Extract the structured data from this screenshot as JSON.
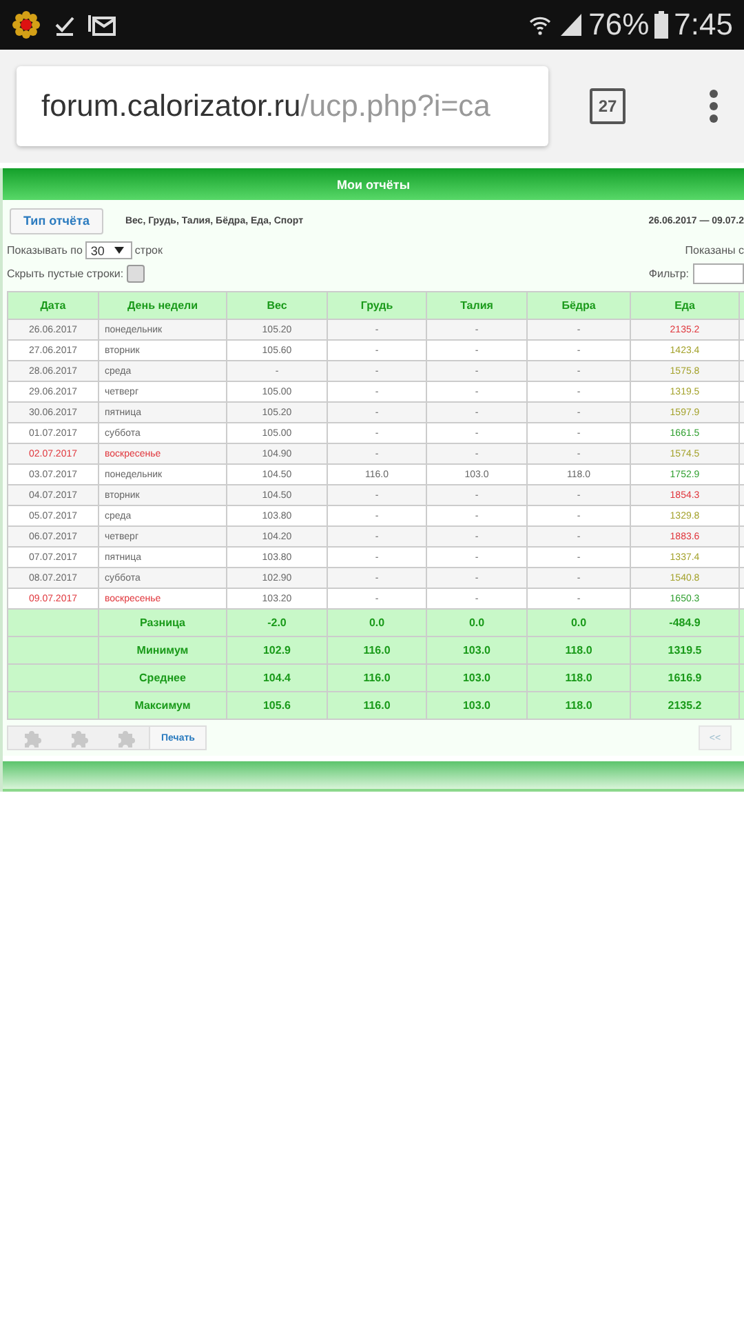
{
  "status_bar": {
    "battery": "76%",
    "time": "7:45"
  },
  "browser": {
    "url_host": "forum.calorizator.ru",
    "url_path": "/ucp.php?i=ca",
    "tab_count": "27"
  },
  "panel": {
    "title": "Мои отчёты",
    "report_type_button": "Тип отчёта",
    "report_fields": "Вес, Грудь, Талия, Бёдра, Еда, Спорт",
    "date_range": "26.06.2017 — 09.07.2",
    "show_label": "Показывать по",
    "rows_per_page": "30",
    "rows_suffix": "строк",
    "shown_text": "Показаны с",
    "hide_empty_label": "Скрыть пустые строки:",
    "hide_empty_checked": false,
    "filter_label": "Фильтр:"
  },
  "table": {
    "columns": [
      "Дата",
      "День недели",
      "Вес",
      "Грудь",
      "Талия",
      "Бёдра",
      "Еда"
    ],
    "rows": [
      {
        "cells": [
          "26.06.2017",
          "понедельник",
          "105.20",
          "-",
          "-",
          "-",
          "2135.2"
        ],
        "weekend": false,
        "color": "#e0353b"
      },
      {
        "cells": [
          "27.06.2017",
          "вторник",
          "105.60",
          "-",
          "-",
          "-",
          "1423.4"
        ],
        "weekend": false,
        "color": "#a3a12a"
      },
      {
        "cells": [
          "28.06.2017",
          "среда",
          "-",
          "-",
          "-",
          "-",
          "1575.8"
        ],
        "weekend": false,
        "color": "#a3a12a"
      },
      {
        "cells": [
          "29.06.2017",
          "четверг",
          "105.00",
          "-",
          "-",
          "-",
          "1319.5"
        ],
        "weekend": false,
        "color": "#a3a12a"
      },
      {
        "cells": [
          "30.06.2017",
          "пятница",
          "105.20",
          "-",
          "-",
          "-",
          "1597.9"
        ],
        "weekend": false,
        "color": "#a3a12a"
      },
      {
        "cells": [
          "01.07.2017",
          "суббота",
          "105.00",
          "-",
          "-",
          "-",
          "1661.5"
        ],
        "weekend": false,
        "color": "#2e9e2e"
      },
      {
        "cells": [
          "02.07.2017",
          "воскресенье",
          "104.90",
          "-",
          "-",
          "-",
          "1574.5"
        ],
        "weekend": true,
        "color": "#a3a12a"
      },
      {
        "cells": [
          "03.07.2017",
          "понедельник",
          "104.50",
          "116.0",
          "103.0",
          "118.0",
          "1752.9"
        ],
        "weekend": false,
        "color": "#2e9e2e"
      },
      {
        "cells": [
          "04.07.2017",
          "вторник",
          "104.50",
          "-",
          "-",
          "-",
          "1854.3"
        ],
        "weekend": false,
        "color": "#e0353b"
      },
      {
        "cells": [
          "05.07.2017",
          "среда",
          "103.80",
          "-",
          "-",
          "-",
          "1329.8"
        ],
        "weekend": false,
        "color": "#a3a12a"
      },
      {
        "cells": [
          "06.07.2017",
          "четверг",
          "104.20",
          "-",
          "-",
          "-",
          "1883.6"
        ],
        "weekend": false,
        "color": "#e0353b"
      },
      {
        "cells": [
          "07.07.2017",
          "пятница",
          "103.80",
          "-",
          "-",
          "-",
          "1337.4"
        ],
        "weekend": false,
        "color": "#a3a12a"
      },
      {
        "cells": [
          "08.07.2017",
          "суббота",
          "102.90",
          "-",
          "-",
          "-",
          "1540.8"
        ],
        "weekend": false,
        "color": "#a3a12a"
      },
      {
        "cells": [
          "09.07.2017",
          "воскресенье",
          "103.20",
          "-",
          "-",
          "-",
          "1650.3"
        ],
        "weekend": true,
        "color": "#2e9e2e"
      },
      {
        "kind": "summary",
        "cells": [
          "",
          "Разница",
          "-2.0",
          "0.0",
          "0.0",
          "0.0",
          "-484.9"
        ]
      },
      {
        "kind": "summary",
        "cells": [
          "",
          "Минимум",
          "102.9",
          "116.0",
          "103.0",
          "118.0",
          "1319.5"
        ]
      },
      {
        "kind": "summary",
        "cells": [
          "",
          "Среднее",
          "104.4",
          "116.0",
          "103.0",
          "118.0",
          "1616.9"
        ]
      },
      {
        "kind": "summary",
        "cells": [
          "",
          "Максимум",
          "105.6",
          "116.0",
          "103.0",
          "118.0",
          "2135.2"
        ]
      }
    ]
  },
  "footer": {
    "print_button": "Печать",
    "first_page_button": "<<"
  }
}
